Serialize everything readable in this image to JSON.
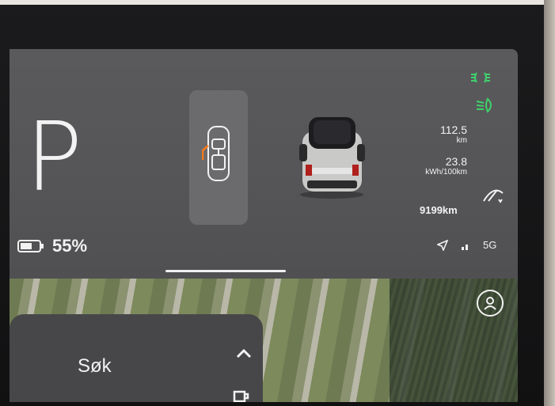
{
  "cluster": {
    "gear": "P",
    "range": {
      "value": "112.5",
      "unit": "km"
    },
    "efficiency": {
      "value": "23.8",
      "unit": "kWh/100km"
    },
    "odometer": "9199km",
    "battery_percent": "55%",
    "network": "5G"
  },
  "map": {
    "search_label": "Søk"
  },
  "colors": {
    "indicator_green": "#3fd06b",
    "door_open_orange": "#ff7a1a",
    "text": "#f2f2f2"
  },
  "icons": {
    "headlight_parking": "parking-light-icon",
    "headlight_low": "low-beam-icon",
    "wiper": "wiper-icon",
    "battery": "battery-icon",
    "navigation": "navigation-arrow-icon",
    "signal": "signal-icon",
    "profile": "profile-icon",
    "chevron": "chevron-up-icon",
    "cup": "cup-icon"
  }
}
